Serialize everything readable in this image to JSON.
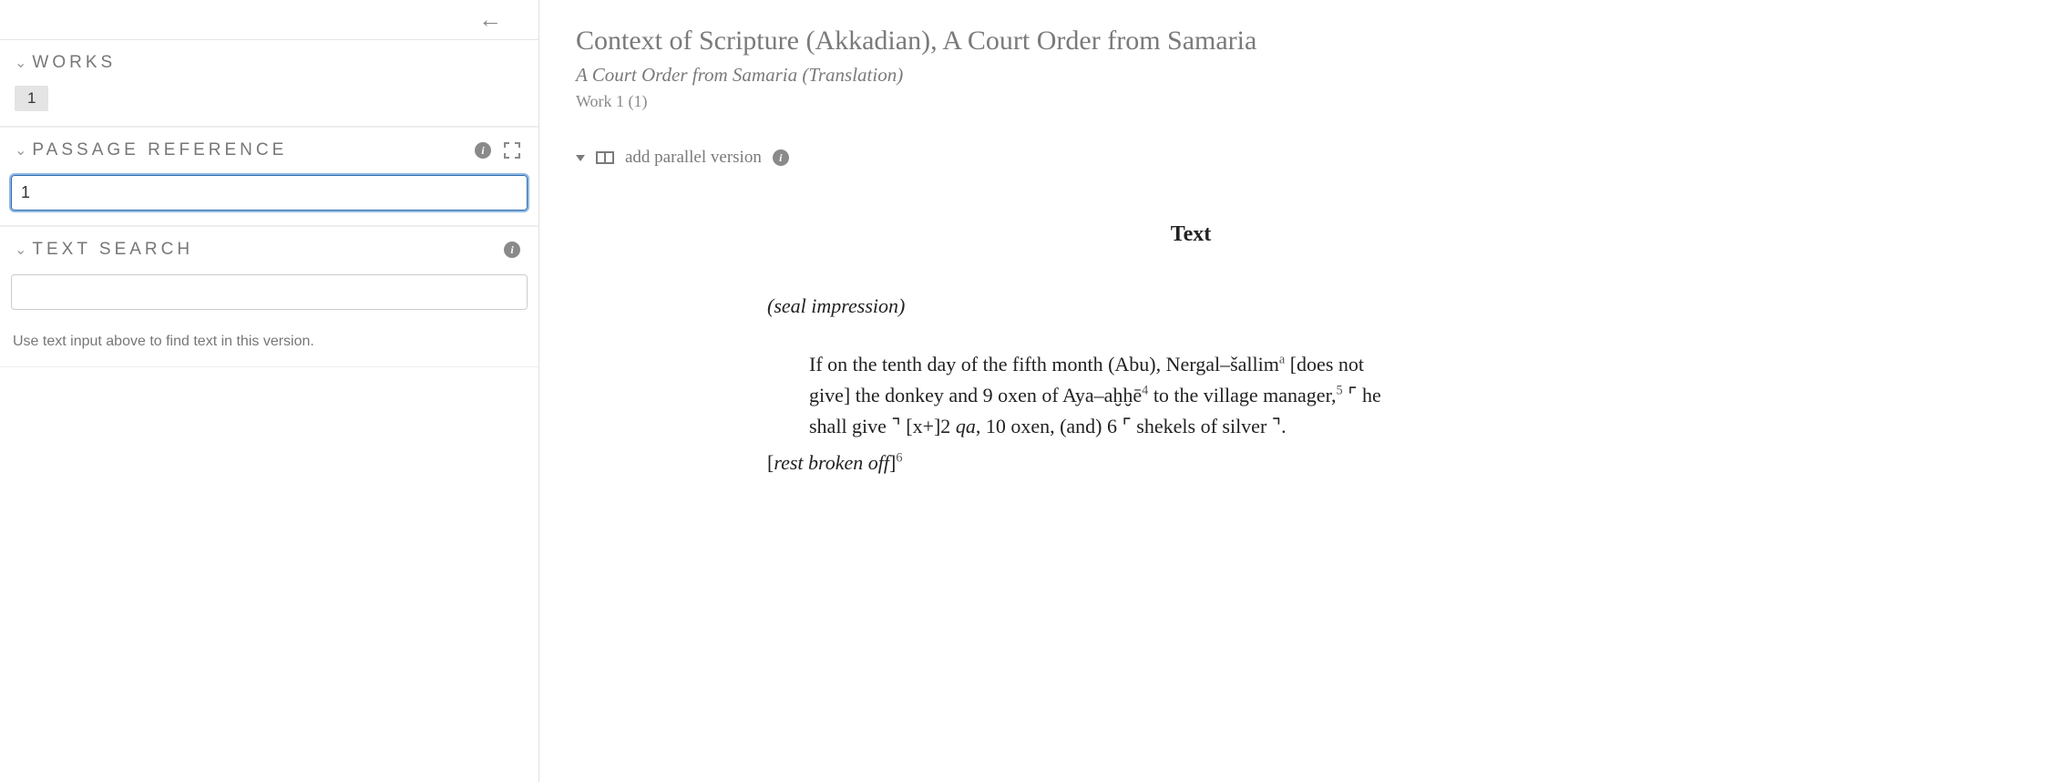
{
  "sidebar": {
    "works": {
      "title": "WORKS",
      "items": [
        "1"
      ]
    },
    "passage": {
      "title": "PASSAGE REFERENCE",
      "value": "1"
    },
    "search": {
      "title": "TEXT SEARCH",
      "value": "",
      "hint": "Use text input above to find text in this version."
    }
  },
  "main": {
    "title": "Context of Scripture (Akkadian), A Court Order from Samaria",
    "subtitle": "A Court Order from Samaria (Translation)",
    "work_line": "Work 1 (1)",
    "parallel_label": "add parallel version",
    "text_heading": "Text",
    "seal_line": "(seal impression)",
    "body_prefix": "If on the tenth day of the fifth month (Abu), Nergal–šallim",
    "sup_a": "a",
    "body_mid1": " [does not give] the donkey and 9 oxen of Aya–aḫḫē",
    "sup_4": "4",
    "body_mid2": " to the village manager,",
    "sup_5": "5",
    "body_mid3": " ⌜ he shall give ⌝ [x+]2 ",
    "qa": "qa",
    "body_mid4": ", 10 oxen, (and) 6 ⌜ shekels of silver ⌝.",
    "rest_open": "[",
    "rest_text": "rest broken off",
    "rest_close": "]",
    "sup_6": "6"
  }
}
